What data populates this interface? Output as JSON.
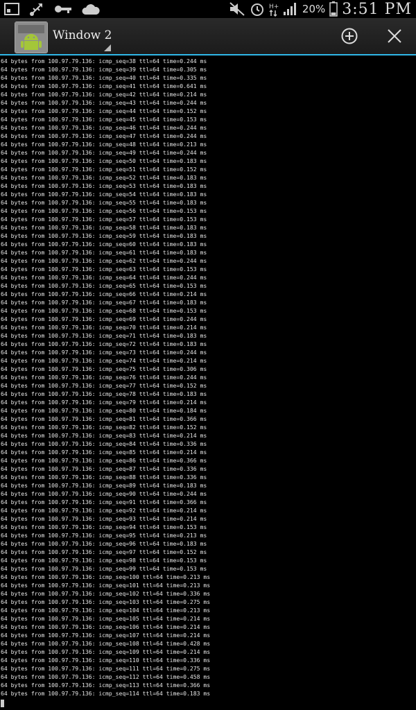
{
  "status_bar": {
    "battery_percent": "20%",
    "time": "3:51 PM",
    "icons": [
      "screen-icon",
      "usb-icon",
      "key-icon",
      "cloud-icon",
      "mute-icon",
      "alarm-icon",
      "data-arrows-icon",
      "signal-icon",
      "battery-icon"
    ]
  },
  "window": {
    "title": "Window 2",
    "icons": [
      "android-app-icon",
      "add-window-icon",
      "close-window-icon"
    ]
  },
  "terminal": {
    "host": "100.97.79.136",
    "lines": [
      "64 bytes from 100.97.79.136: icmp_seq=38 ttl=64 time=0.244 ms",
      "64 bytes from 100.97.79.136: icmp_seq=39 ttl=64 time=0.305 ms",
      "64 bytes from 100.97.79.136: icmp_seq=40 ttl=64 time=0.335 ms",
      "64 bytes from 100.97.79.136: icmp_seq=41 ttl=64 time=0.641 ms",
      "64 bytes from 100.97.79.136: icmp_seq=42 ttl=64 time=0.214 ms",
      "64 bytes from 100.97.79.136: icmp_seq=43 ttl=64 time=0.244 ms",
      "64 bytes from 100.97.79.136: icmp_seq=44 ttl=64 time=0.152 ms",
      "64 bytes from 100.97.79.136: icmp_seq=45 ttl=64 time=0.153 ms",
      "64 bytes from 100.97.79.136: icmp_seq=46 ttl=64 time=0.244 ms",
      "64 bytes from 100.97.79.136: icmp_seq=47 ttl=64 time=0.244 ms",
      "64 bytes from 100.97.79.136: icmp_seq=48 ttl=64 time=0.213 ms",
      "64 bytes from 100.97.79.136: icmp_seq=49 ttl=64 time=0.244 ms",
      "64 bytes from 100.97.79.136: icmp_seq=50 ttl=64 time=0.183 ms",
      "64 bytes from 100.97.79.136: icmp_seq=51 ttl=64 time=0.152 ms",
      "64 bytes from 100.97.79.136: icmp_seq=52 ttl=64 time=0.183 ms",
      "64 bytes from 100.97.79.136: icmp_seq=53 ttl=64 time=0.183 ms",
      "64 bytes from 100.97.79.136: icmp_seq=54 ttl=64 time=0.183 ms",
      "64 bytes from 100.97.79.136: icmp_seq=55 ttl=64 time=0.183 ms",
      "64 bytes from 100.97.79.136: icmp_seq=56 ttl=64 time=0.153 ms",
      "64 bytes from 100.97.79.136: icmp_seq=57 ttl=64 time=0.153 ms",
      "64 bytes from 100.97.79.136: icmp_seq=58 ttl=64 time=0.183 ms",
      "64 bytes from 100.97.79.136: icmp_seq=59 ttl=64 time=0.183 ms",
      "64 bytes from 100.97.79.136: icmp_seq=60 ttl=64 time=0.183 ms",
      "64 bytes from 100.97.79.136: icmp_seq=61 ttl=64 time=0.183 ms",
      "64 bytes from 100.97.79.136: icmp_seq=62 ttl=64 time=0.244 ms",
      "64 bytes from 100.97.79.136: icmp_seq=63 ttl=64 time=0.153 ms",
      "64 bytes from 100.97.79.136: icmp_seq=64 ttl=64 time=0.244 ms",
      "64 bytes from 100.97.79.136: icmp_seq=65 ttl=64 time=0.153 ms",
      "64 bytes from 100.97.79.136: icmp_seq=66 ttl=64 time=0.214 ms",
      "64 bytes from 100.97.79.136: icmp_seq=67 ttl=64 time=0.183 ms",
      "64 bytes from 100.97.79.136: icmp_seq=68 ttl=64 time=0.153 ms",
      "64 bytes from 100.97.79.136: icmp_seq=69 ttl=64 time=0.244 ms",
      "64 bytes from 100.97.79.136: icmp_seq=70 ttl=64 time=0.214 ms",
      "64 bytes from 100.97.79.136: icmp_seq=71 ttl=64 time=0.183 ms",
      "64 bytes from 100.97.79.136: icmp_seq=72 ttl=64 time=0.183 ms",
      "64 bytes from 100.97.79.136: icmp_seq=73 ttl=64 time=0.244 ms",
      "64 bytes from 100.97.79.136: icmp_seq=74 ttl=64 time=0.214 ms",
      "64 bytes from 100.97.79.136: icmp_seq=75 ttl=64 time=0.306 ms",
      "64 bytes from 100.97.79.136: icmp_seq=76 ttl=64 time=0.244 ms",
      "64 bytes from 100.97.79.136: icmp_seq=77 ttl=64 time=0.152 ms",
      "64 bytes from 100.97.79.136: icmp_seq=78 ttl=64 time=0.183 ms",
      "64 bytes from 100.97.79.136: icmp_seq=79 ttl=64 time=0.214 ms",
      "64 bytes from 100.97.79.136: icmp_seq=80 ttl=64 time=0.184 ms",
      "64 bytes from 100.97.79.136: icmp_seq=81 ttl=64 time=0.366 ms",
      "64 bytes from 100.97.79.136: icmp_seq=82 ttl=64 time=0.152 ms",
      "64 bytes from 100.97.79.136: icmp_seq=83 ttl=64 time=0.214 ms",
      "64 bytes from 100.97.79.136: icmp_seq=84 ttl=64 time=0.336 ms",
      "64 bytes from 100.97.79.136: icmp_seq=85 ttl=64 time=0.214 ms",
      "64 bytes from 100.97.79.136: icmp_seq=86 ttl=64 time=0.366 ms",
      "64 bytes from 100.97.79.136: icmp_seq=87 ttl=64 time=0.336 ms",
      "64 bytes from 100.97.79.136: icmp_seq=88 ttl=64 time=0.336 ms",
      "64 bytes from 100.97.79.136: icmp_seq=89 ttl=64 time=0.183 ms",
      "64 bytes from 100.97.79.136: icmp_seq=90 ttl=64 time=0.244 ms",
      "64 bytes from 100.97.79.136: icmp_seq=91 ttl=64 time=0.366 ms",
      "64 bytes from 100.97.79.136: icmp_seq=92 ttl=64 time=0.214 ms",
      "64 bytes from 100.97.79.136: icmp_seq=93 ttl=64 time=0.214 ms",
      "64 bytes from 100.97.79.136: icmp_seq=94 ttl=64 time=0.153 ms",
      "64 bytes from 100.97.79.136: icmp_seq=95 ttl=64 time=0.213 ms",
      "64 bytes from 100.97.79.136: icmp_seq=96 ttl=64 time=0.183 ms",
      "64 bytes from 100.97.79.136: icmp_seq=97 ttl=64 time=0.152 ms",
      "64 bytes from 100.97.79.136: icmp_seq=98 ttl=64 time=0.153 ms",
      "64 bytes from 100.97.79.136: icmp_seq=99 ttl=64 time=0.153 ms",
      "64 bytes from 100.97.79.136: icmp_seq=100 ttl=64 time=0.213 ms",
      "64 bytes from 100.97.79.136: icmp_seq=101 ttl=64 time=0.213 ms",
      "64 bytes from 100.97.79.136: icmp_seq=102 ttl=64 time=0.336 ms",
      "64 bytes from 100.97.79.136: icmp_seq=103 ttl=64 time=0.275 ms",
      "64 bytes from 100.97.79.136: icmp_seq=104 ttl=64 time=0.213 ms",
      "64 bytes from 100.97.79.136: icmp_seq=105 ttl=64 time=0.214 ms",
      "64 bytes from 100.97.79.136: icmp_seq=106 ttl=64 time=0.214 ms",
      "64 bytes from 100.97.79.136: icmp_seq=107 ttl=64 time=0.214 ms",
      "64 bytes from 100.97.79.136: icmp_seq=108 ttl=64 time=0.428 ms",
      "64 bytes from 100.97.79.136: icmp_seq=109 ttl=64 time=0.214 ms",
      "64 bytes from 100.97.79.136: icmp_seq=110 ttl=64 time=0.336 ms",
      "64 bytes from 100.97.79.136: icmp_seq=111 ttl=64 time=0.275 ms",
      "64 bytes from 100.97.79.136: icmp_seq=112 ttl=64 time=0.458 ms",
      "64 bytes from 100.97.79.136: icmp_seq=113 ttl=64 time=0.366 ms",
      "64 bytes from 100.97.79.136: icmp_seq=114 ttl=64 time=0.183 ms"
    ]
  }
}
